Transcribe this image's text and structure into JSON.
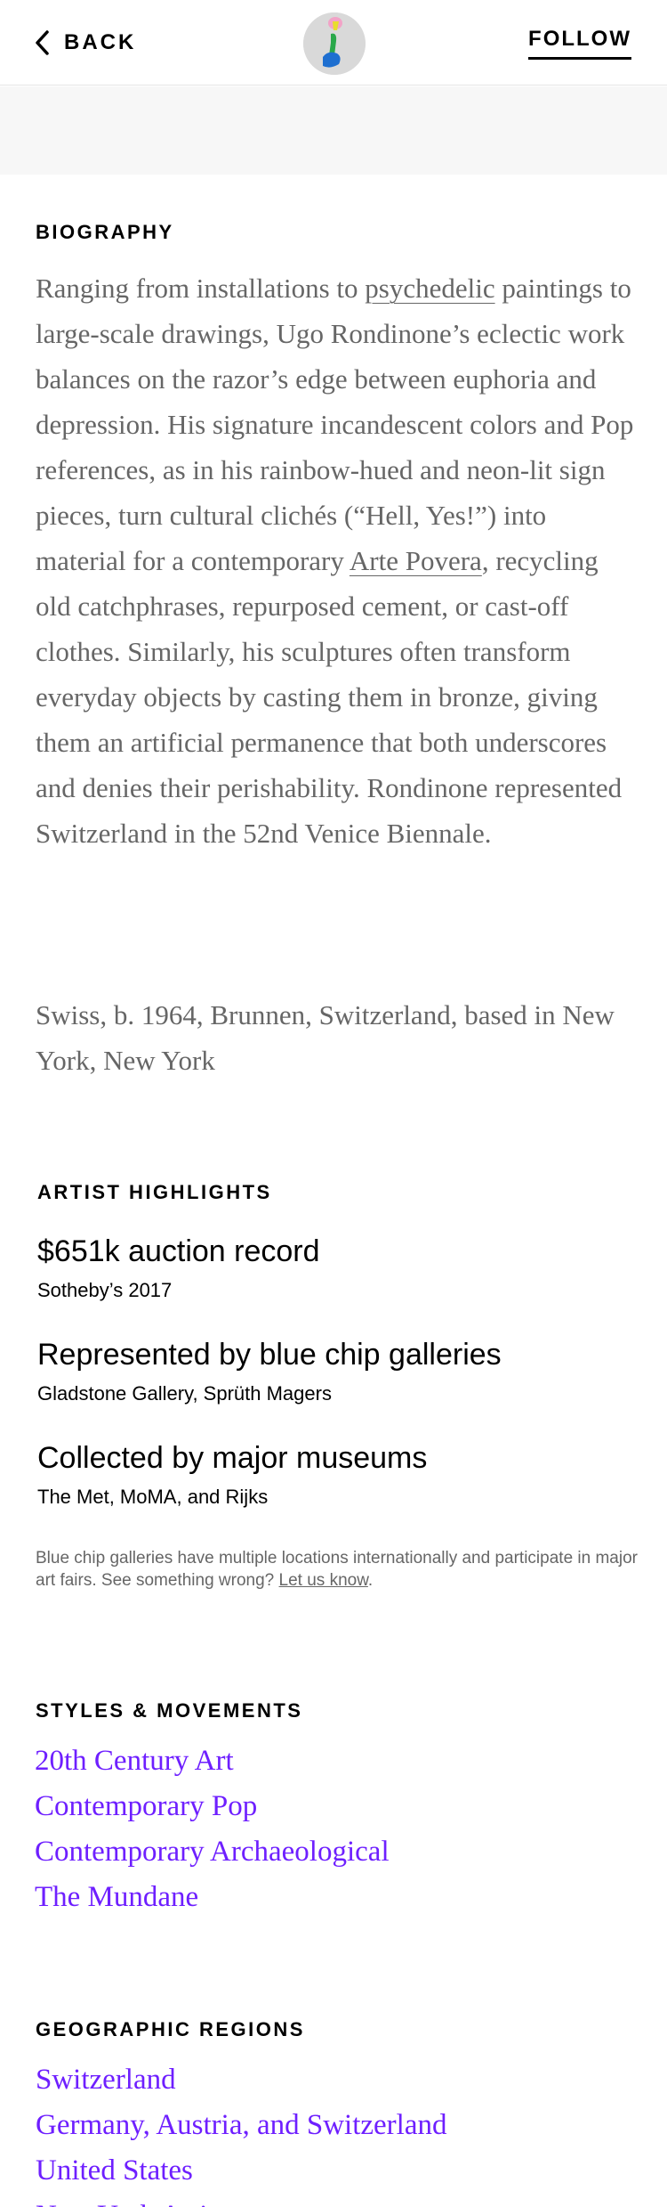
{
  "header": {
    "back_label": "BACK",
    "follow_label": "FOLLOW"
  },
  "biography": {
    "title": "BIOGRAPHY",
    "text_before": "Ranging from installations to ",
    "link1": "psychedelic",
    "text_middle": " paintings to large-scale drawings, Ugo Rondinone’s eclectic work balances on the razor’s edge between euphoria and depression. His signature incandescent colors and Pop references, as in his rainbow-hued and neon-lit sign pieces, turn cultural clichés (“Hell, Yes!”) into material for a contemporary ",
    "link2": "Arte Povera",
    "text_after": ", recycling old catchphrases, repurposed cement, or cast-off clothes. Similarly, his sculptures often transform everyday objects by casting them in bronze, giving them an artificial permanence that both underscores and denies their perishability. Rondinone represented Switzerland in the 52nd Venice Biennale.",
    "meta": "Swiss, b. 1964, Brunnen, Switzerland, based in New York, New York"
  },
  "highlights": {
    "title": "ARTIST HIGHLIGHTS",
    "items": [
      {
        "heading": "$651k auction record",
        "sub": "Sotheby’s 2017"
      },
      {
        "heading": "Represented by blue chip galleries",
        "sub": "Gladstone Gallery, Sprüth Magers"
      },
      {
        "heading": "Collected by major museums",
        "sub": "The Met, MoMA, and Rijks"
      }
    ],
    "disclaimer_text": "Blue chip galleries have multiple locations internationally and participate in major art fairs. See something wrong? ",
    "disclaimer_link": "Let us know",
    "disclaimer_end": "."
  },
  "styles": {
    "title": "STYLES & MOVEMENTS",
    "items": [
      "20th Century Art",
      "Contemporary Pop",
      "Contemporary Archaeological",
      "The Mundane"
    ]
  },
  "regions": {
    "title": "GEOGRAPHIC REGIONS",
    "items": [
      "Switzerland",
      "Germany, Austria, and Switzerland",
      "United States",
      "New York Artists"
    ]
  },
  "colors": {
    "accent": "#6e1fff",
    "body_text": "#666666"
  }
}
